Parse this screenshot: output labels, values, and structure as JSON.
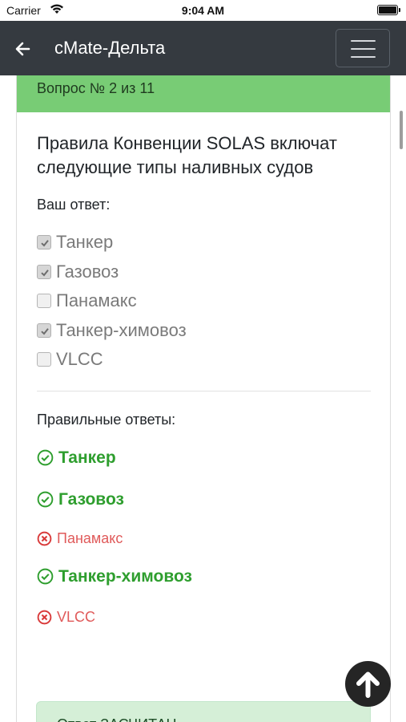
{
  "status_bar": {
    "carrier": "Carrier",
    "time": "9:04 AM"
  },
  "navbar": {
    "title": "cMate-Дельта",
    "back_icon": "arrow-left-icon",
    "menu_icon": "hamburger-icon"
  },
  "card": {
    "header": "Вопрос № 2 из 11",
    "question": "Правила Конвенции SOLAS включат следующие типы наливных судов",
    "your_answer_label": "Ваш ответ:",
    "options": [
      {
        "label": "Танкер",
        "checked": true
      },
      {
        "label": "Газовоз",
        "checked": true
      },
      {
        "label": "Панамакс",
        "checked": false
      },
      {
        "label": "Танкер-химовоз",
        "checked": true
      },
      {
        "label": "VLCC",
        "checked": false
      }
    ],
    "correct_answers_label": "Правильные ответы:",
    "correct_answers": [
      {
        "label": "Танкер",
        "correct": true
      },
      {
        "label": "Газовоз",
        "correct": true
      },
      {
        "label": "Панамакс",
        "correct": false
      },
      {
        "label": "Танкер-химовоз",
        "correct": true
      },
      {
        "label": "VLCC",
        "correct": false
      }
    ],
    "verdict": "Ответ ЗАСЧИТАН"
  },
  "colors": {
    "header_green": "#78cc75",
    "navbar": "#353a40",
    "correct_green": "#2e9e2e",
    "wrong_red": "#e05a5a"
  }
}
